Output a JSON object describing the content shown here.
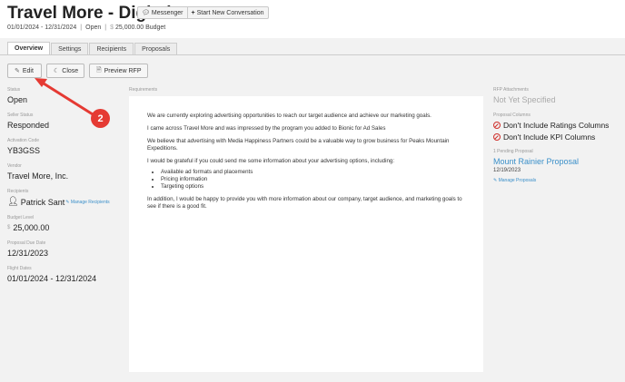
{
  "header": {
    "title": "Travel More - Digital",
    "messenger_label": "Messenger",
    "start_conversation_label": "Start New Conversation",
    "date_range": "01/01/2024 - 12/31/2024",
    "status": "Open",
    "budget": "25,000.00 Budget",
    "dollar_sign": "$",
    "separator": "|"
  },
  "tabs": [
    {
      "label": "Overview",
      "active": true
    },
    {
      "label": "Settings",
      "active": false
    },
    {
      "label": "Recipients",
      "active": false
    },
    {
      "label": "Proposals",
      "active": false
    }
  ],
  "actions": {
    "edit_label": "Edit",
    "close_label": "Close",
    "preview_label": "Preview RFP"
  },
  "details": {
    "status_label": "Status",
    "status_value": "Open",
    "seller_status_label": "Seller Status",
    "seller_status_value": "Responded",
    "activation_code_label": "Activation Code",
    "activation_code_value": "YB3GSS",
    "vendor_label": "Vendor",
    "vendor_value": "Travel More, Inc.",
    "recipients_label": "Recipients",
    "recipient_name": "Patrick Sant",
    "manage_recipients_label": "Manage Recipients",
    "budget_level_label": "Budget Level",
    "budget_currency": "$",
    "budget_value": "25,000.00",
    "due_date_label": "Proposal Due Date",
    "due_date_value": "12/31/2023",
    "flight_dates_label": "Flight Dates",
    "flight_dates_value": "01/01/2024 - 12/31/2024"
  },
  "requirements": {
    "label": "Requirements",
    "p1": "We are currently exploring advertising opportunities to reach our target audience and achieve our marketing goals.",
    "p2": "I came across Travel More and was impressed by the program you added to Bionic for Ad Sales",
    "p3": "We believe that advertising with Media Happiness Partners could be a valuable way to grow business for Peaks Mountain Expeditions.",
    "p4": "I would be grateful if you could send me some information about your advertising options, including:",
    "bullets": [
      "Available ad formats and placements",
      "Pricing information",
      "Targeting options"
    ],
    "p5": "In addition, I would be happy to provide you with more information about our company, target audience, and marketing goals to see if there is a good fit."
  },
  "sidebar_right": {
    "attachments_label": "RFP Attachments",
    "attachments_value": "Not Yet Specified",
    "proposal_columns_label": "Proposal Columns",
    "exclusions": [
      "Don't Include Ratings Columns",
      "Don't Include KPI Columns"
    ],
    "pending_label": "1 Pending Proposal",
    "proposal_name": "Mount Rainier Proposal",
    "proposal_date": "12/19/2023",
    "manage_proposals_label": "Manage Proposals"
  },
  "annotation": {
    "step_number": "2",
    "color": "#e53a33"
  },
  "colors": {
    "link": "#3a8fc9",
    "danger": "#d0312d",
    "background": "#f2f2f2"
  }
}
